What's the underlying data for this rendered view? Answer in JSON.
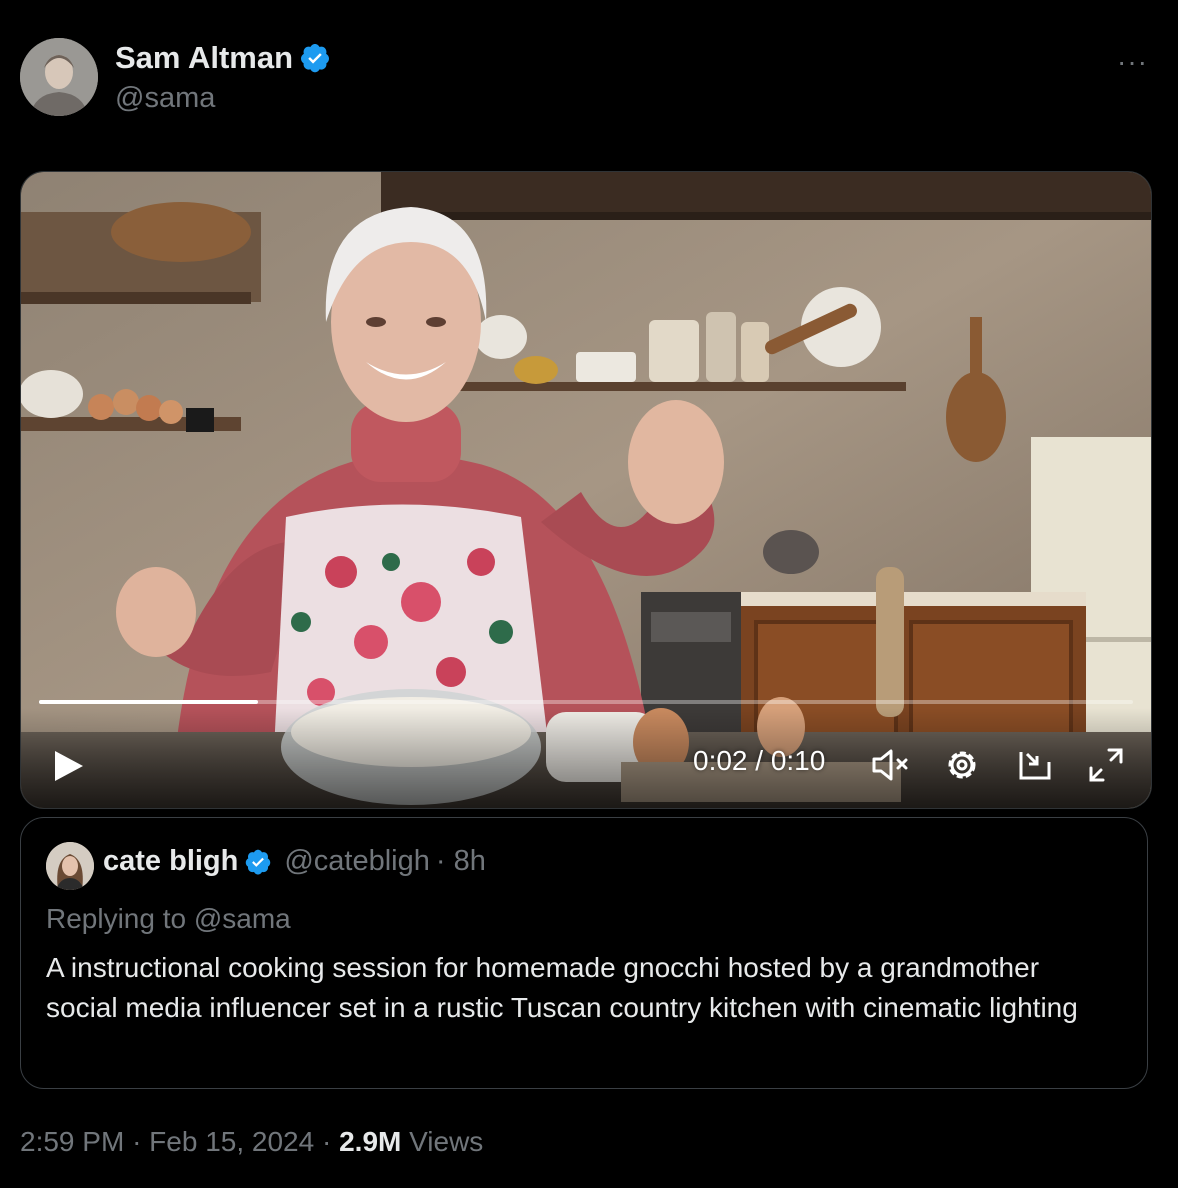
{
  "post": {
    "author_name": "Sam Altman",
    "author_handle": "@sama",
    "more_label": "···"
  },
  "video": {
    "current_time": "0:02",
    "duration": "0:10",
    "time_display": "0:02 / 0:10",
    "progress_fraction": 0.2
  },
  "quote": {
    "author_name": "cate bligh",
    "author_handle": "@catebligh",
    "age": "· 8h",
    "replying_to": "Replying to @sama",
    "text": "A instructional cooking session for homemade gnocchi hosted by a grandmother social media influencer set in a rustic Tuscan country kitchen with cinematic lighting"
  },
  "footer": {
    "time": "2:59 PM",
    "date": "Feb 15, 2024",
    "views_count": "2.9M",
    "views_label": "Views"
  },
  "colors": {
    "verified": "#1d9bf0",
    "secondary_text": "#71767b"
  }
}
